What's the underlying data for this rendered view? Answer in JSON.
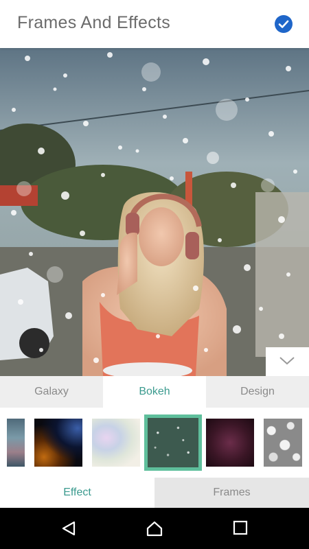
{
  "header": {
    "title": "Frames And Effects",
    "confirm_icon": "check-circle-icon",
    "accent": "#1f66c9"
  },
  "categories": [
    {
      "label": "Galaxy",
      "active": false
    },
    {
      "label": "Bokeh",
      "active": true
    },
    {
      "label": "Design",
      "active": false
    }
  ],
  "effect_thumbnails": {
    "count_visible": 6,
    "selected_index": 3,
    "selected_border_color": "#5fbf9c"
  },
  "bottom_tabs": [
    {
      "label": "Effect",
      "active": true
    },
    {
      "label": "Frames",
      "active": false
    }
  ],
  "colors": {
    "active_tab_text": "#3a9a8e",
    "inactive_tab_text": "#8a8a8a"
  },
  "navbar": {
    "icons": [
      "back-triangle-icon",
      "home-icon",
      "recents-square-icon"
    ]
  }
}
